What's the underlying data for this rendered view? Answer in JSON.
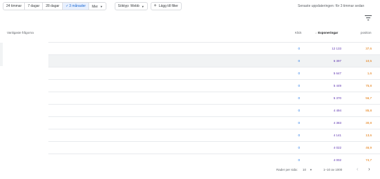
{
  "toolbar": {
    "segments": [
      {
        "label": "24 timmar",
        "active": false
      },
      {
        "label": "7 dagar",
        "active": false
      },
      {
        "label": "28 dagar",
        "active": false
      },
      {
        "label": "3 månader",
        "active": true
      },
      {
        "label": "Mer",
        "active": false
      }
    ],
    "search_type_label": "Söktyp: Webb",
    "add_filter_label": "Lägg till filter",
    "last_updated": "Senaste uppdateringen: för 3 timmar sedan"
  },
  "table": {
    "headers": {
      "query": "Vanligaste frågorna",
      "clicks": "Klick",
      "impressions": "Exponeringar",
      "position": "position"
    },
    "rows": [
      {
        "clicks": "0",
        "impressions": "12 133",
        "position": "37,6"
      },
      {
        "clicks": "0",
        "impressions": "6 397",
        "position": "10,5"
      },
      {
        "clicks": "0",
        "impressions": "5 647",
        "position": "1,6"
      },
      {
        "clicks": "0",
        "impressions": "5 449",
        "position": "75,8"
      },
      {
        "clicks": "0",
        "impressions": "5 370",
        "position": "56,7"
      },
      {
        "clicks": "0",
        "impressions": "4 494",
        "position": "85,8"
      },
      {
        "clicks": "0",
        "impressions": "4 383",
        "position": "30,8"
      },
      {
        "clicks": "0",
        "impressions": "4 141",
        "position": "13,6"
      },
      {
        "clicks": "0",
        "impressions": "4 022",
        "position": "46,9"
      },
      {
        "clicks": "0",
        "impressions": "4 002",
        "position": "74,7"
      }
    ]
  },
  "footer": {
    "rows_per_page_label": "Rader per sida:",
    "rows_per_page_value": "10",
    "range_label": "1–10 av 1000"
  },
  "colors": {
    "clicks": "#1a73e8",
    "impressions": "#5e35b1",
    "position": "#e37400",
    "active_segment": "#e8f0fe"
  },
  "icons": [
    "check-icon",
    "chevron-down-icon",
    "plus-icon",
    "filter-icon",
    "arrow-down-icon",
    "chevron-left-icon",
    "chevron-right-icon"
  ]
}
